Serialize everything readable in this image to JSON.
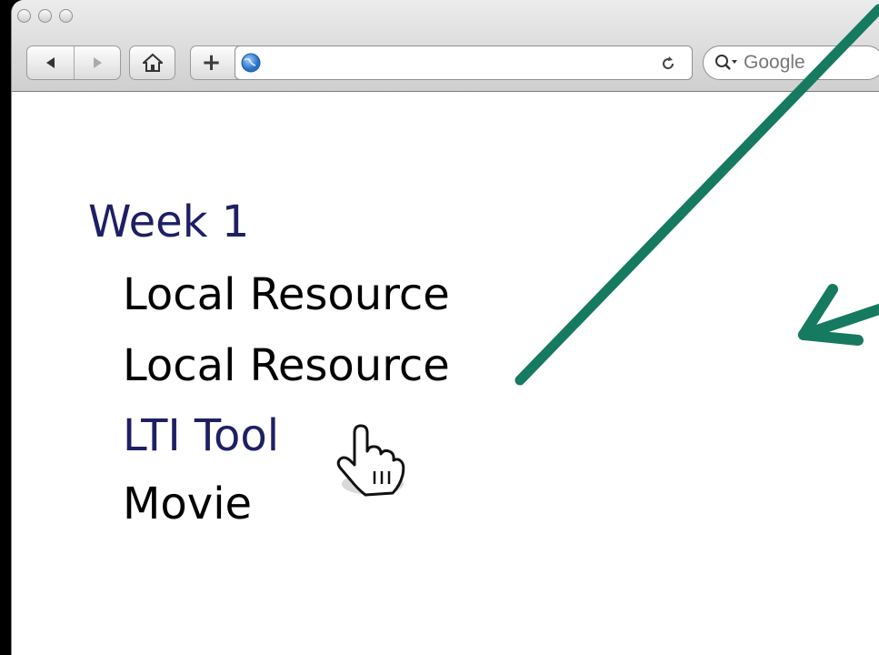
{
  "browser": {
    "nav_buttons": {
      "back_icon": "back-arrow-icon",
      "forward_icon": "forward-arrow-icon"
    },
    "home_icon": "home-icon",
    "add_tab_label": "+",
    "globe_icon": "globe-icon",
    "address_value": "",
    "reload_icon": "reload-icon",
    "search": {
      "icon": "magnifier-icon",
      "placeholder": "Google"
    }
  },
  "page": {
    "week_title": "Week 1",
    "items": [
      {
        "label": "Local Resource",
        "type": "text"
      },
      {
        "label": "Local Resource",
        "type": "text"
      },
      {
        "label": "LTI Tool",
        "type": "link"
      },
      {
        "label": "Movie",
        "type": "text"
      }
    ]
  },
  "annotations": {
    "arrow_color": "#167a60",
    "cursor": "hand-pointer-cursor"
  }
}
